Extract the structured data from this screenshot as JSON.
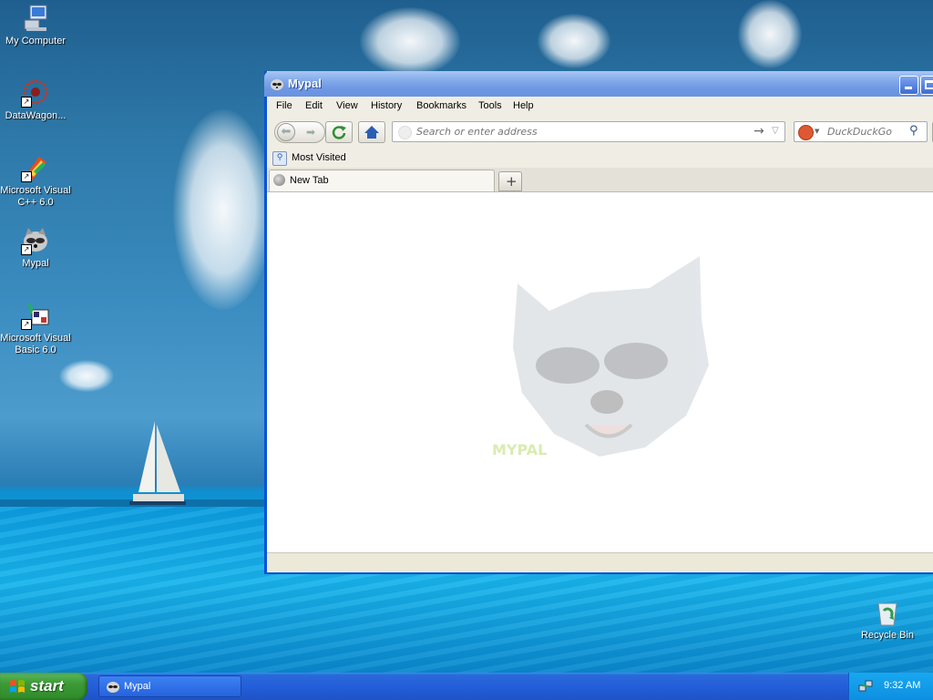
{
  "desktop": {
    "icons": [
      {
        "label": "My Computer"
      },
      {
        "label": "DataWagon..."
      },
      {
        "label": "Microsoft Visual C++ 6.0"
      },
      {
        "label": "Mypal"
      },
      {
        "label": "Microsoft Visual Basic 6.0"
      },
      {
        "label": "Recycle Bin"
      }
    ]
  },
  "window": {
    "title": "Mypal",
    "menu": [
      "File",
      "Edit",
      "View",
      "History",
      "Bookmarks",
      "Tools",
      "Help"
    ],
    "address": {
      "placeholder": "Search or enter address"
    },
    "search": {
      "placeholder": "DuckDuckGo"
    },
    "bookmarks": {
      "most_visited": "Most Visited"
    },
    "tabs": [
      {
        "label": "New Tab"
      }
    ],
    "logo_text": "MYPAL"
  },
  "taskbar": {
    "start_label": "start",
    "task_label": "Mypal",
    "clock": "9:32 AM"
  },
  "colors": {
    "titlebar": "#7fa8ea",
    "taskbar": "#245edb",
    "start": "#3c9a37"
  }
}
